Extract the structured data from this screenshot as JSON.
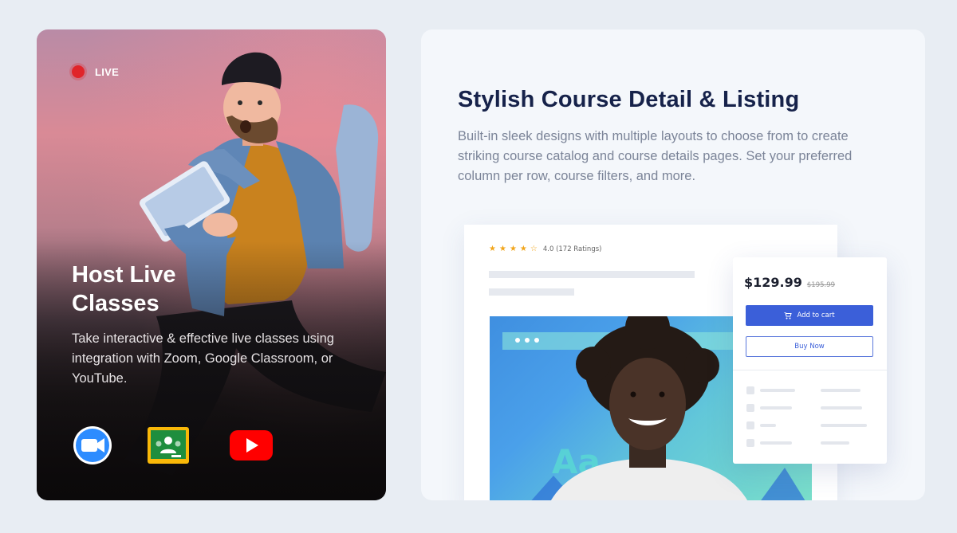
{
  "live_card": {
    "badge": "LIVE",
    "title_line1": "Host Live",
    "title_line2": "Classes",
    "description": "Take interactive & effective live classes using integration with Zoom, Google Classroom, or YouTube.",
    "apps": [
      {
        "name": "zoom-icon",
        "color": "#2d8cff"
      },
      {
        "name": "google-classroom-icon",
        "color": "#1e8e3e"
      },
      {
        "name": "youtube-icon",
        "color": "#ff0000"
      }
    ]
  },
  "feature": {
    "title": "Stylish Course Detail & Listing",
    "description": "Built-in sleek designs with multiple layouts to choose from to create striking course catalog and course details pages. Set your preferred column per row, course filters, and more."
  },
  "mockup": {
    "rating_value": 4.0,
    "rating_text": "4.0 (172 Ratings)",
    "stars_filled": 4,
    "stars_total": 5,
    "image_text": "Aa",
    "price": "$129.99",
    "old_price": "$195.99",
    "add_to_cart": "Add to cart",
    "buy_now": "Buy Now"
  },
  "colors": {
    "accent": "#3b5fd9",
    "title": "#16224a",
    "live_dot": "#e0242a",
    "page_bg": "#e8edf3"
  }
}
